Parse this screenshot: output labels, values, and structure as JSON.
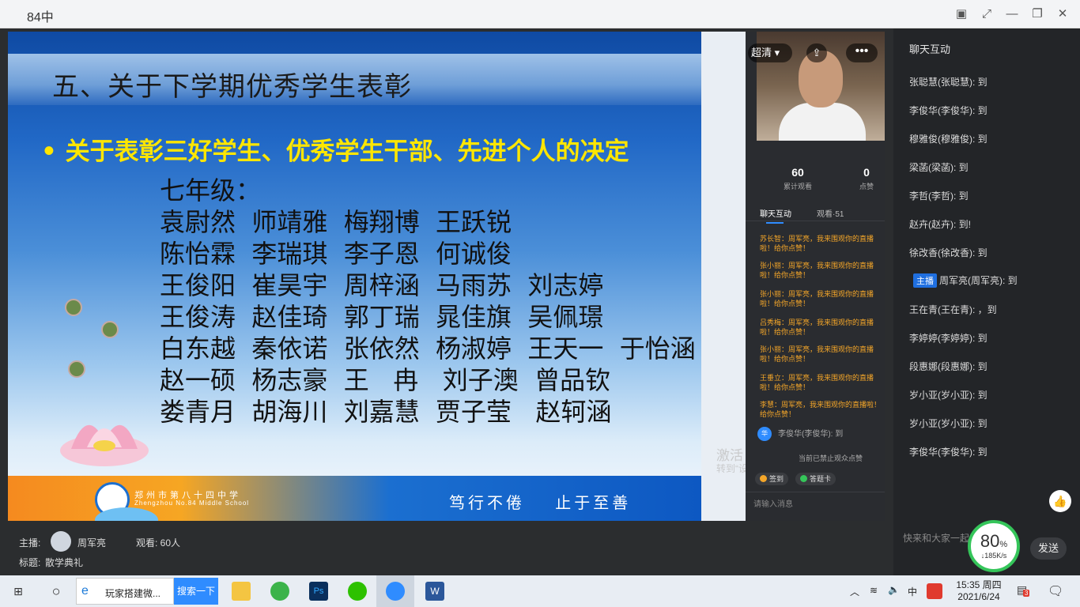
{
  "window": {
    "title": "84中"
  },
  "slide": {
    "heading": "五、关于下学期优秀学生表彰",
    "bullet": "• 关于表彰三好学生、优秀学生干部、先进个人的决定",
    "grade": "七年级：",
    "rows": [
      "袁尉然  师靖雅  梅翔博  王跃锐",
      "陈怡霖  李瑞琪  李子恩  何诚俊",
      "王俊阳  崔昊宇  周梓涵  马雨苏  刘志婷",
      "王俊涛  赵佳琦  郭丁瑞  晁佳旗  吴佩璟",
      "白东越  秦依诺  张依然  杨淑婷  王天一  于怡涵",
      "赵一硕  杨志豪  王   冉   刘子澳  曾品钦",
      "娄青月  胡海川  刘嘉慧  贾子莹   赵轲涵"
    ],
    "school_cn": "郑州市第八十四中学",
    "school_en": "Zhengzhou No.84 Middle School",
    "motto": "笃行不倦    止于至善"
  },
  "live": {
    "quality": "超清",
    "viewers_count": "60",
    "viewers_label": "累计观看",
    "likes_count": "0",
    "likes_label": "点赞",
    "tab_chat": "聊天互动",
    "tab_watch": "观看·51",
    "messages": [
      "苏长智：周军亮，我来围观你的直播啦！给你点赞！",
      "张小丽：周军亮，我来围观你的直播啦！给你点赞！",
      "张小丽：周军亮，我来围观你的直播啦！给你点赞！",
      "吕秀梅：周军亮，我来围观你的直播啦！给你点赞！",
      "张小丽：周军亮，我来围观你的直播啦！给你点赞！",
      "王垂立：周军亮，我来围观你的直播啦！给你点赞！",
      "李慧：周军亮，我来围观你的直播啦！给你点赞！"
    ],
    "last_avatar": "华",
    "last_msg": "李俊华(李俊华): 到",
    "notice": "当前已禁止观众点赞",
    "chip1": "签到",
    "chip2": "答题卡",
    "input_placeholder": "请输入消息",
    "win_watermark1": "激活 Windows",
    "win_watermark2": "转到“设置”以激活 Windows。"
  },
  "info": {
    "host_label": "主播:",
    "host_name": "周军亮",
    "viewers_label": "观看: 60人",
    "title_label": "标题:",
    "title_value": "散学典礼"
  },
  "chat": {
    "header": "聊天互动",
    "messages": [
      {
        "text": "张聪慧(张聪慧): 到"
      },
      {
        "text": "李俊华(李俊华): 到"
      },
      {
        "text": "穆雅俊(穆雅俊): 到"
      },
      {
        "text": "梁菡(梁菡): 到"
      },
      {
        "text": "李哲(李哲): 到"
      },
      {
        "text": "赵卉(赵卉): 到!"
      },
      {
        "text": "徐改香(徐改香): 到"
      },
      {
        "text": "周军亮(周军亮): 到",
        "badge": "主播"
      },
      {
        "text": "王在青(王在青): ，到"
      },
      {
        "text": "李婷婷(李婷婷): 到"
      },
      {
        "text": "段惠娜(段惠娜): 到"
      },
      {
        "text": "岁小亚(岁小亚): 到"
      },
      {
        "text": "岁小亚(岁小亚): 到"
      },
      {
        "text": "李俊华(李俊华): 到"
      }
    ],
    "input_placeholder": "快来和大家一起",
    "send_label": "发送",
    "gauge_percent": "80",
    "gauge_unit": "%",
    "gauge_speed": "↓185K/s"
  },
  "taskbar": {
    "browser_title": "玩家搭建微...",
    "search_button": "搜索一下",
    "ime": "中",
    "time": "15:35 周四",
    "date": "2021/6/24",
    "notif_count": "3"
  }
}
